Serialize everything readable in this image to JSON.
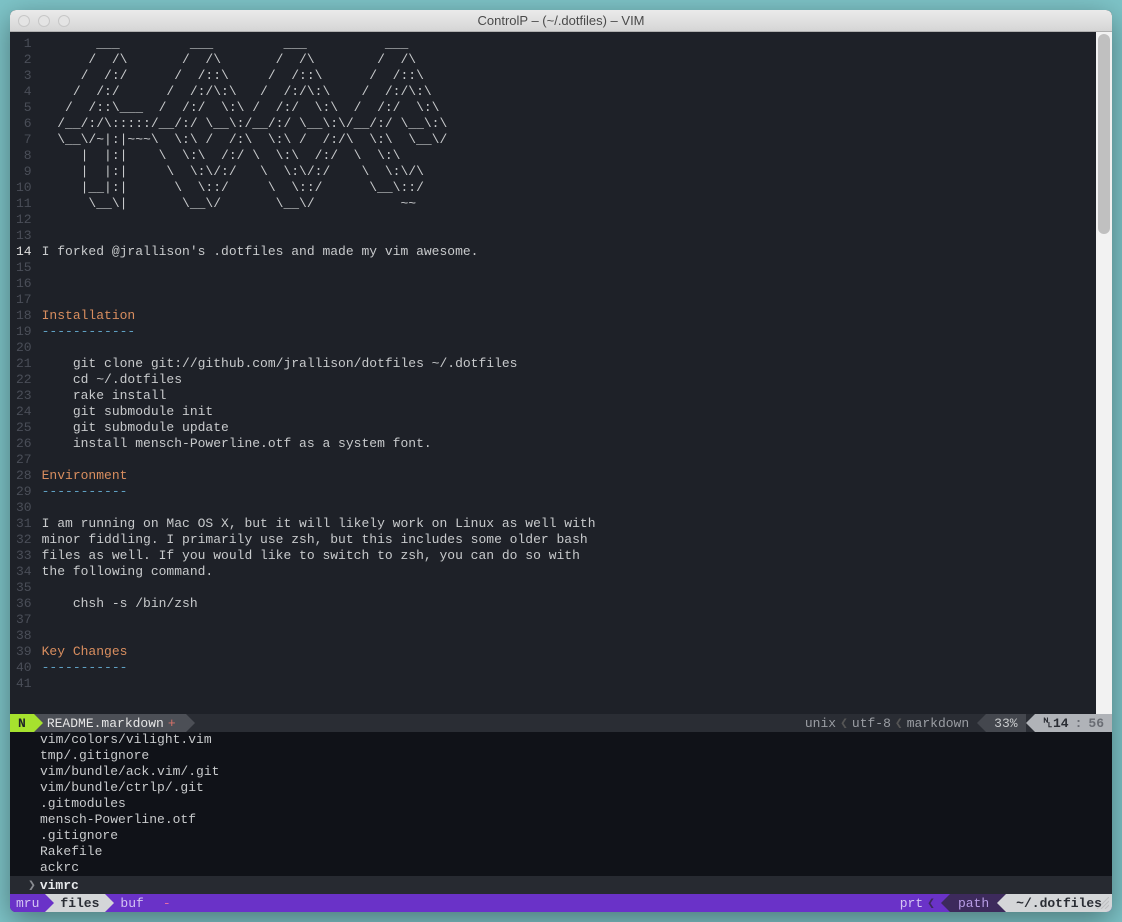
{
  "window": {
    "title": "ControlP – (~/.dotfiles) – VIM"
  },
  "editor": {
    "current_line": 14,
    "lines": [
      {
        "n": 1,
        "t": "       ___         ___         ___          ___"
      },
      {
        "n": 2,
        "t": "      /  /\\       /  /\\       /  /\\        /  /\\"
      },
      {
        "n": 3,
        "t": "     /  /:/      /  /::\\     /  /::\\      /  /::\\"
      },
      {
        "n": 4,
        "t": "    /  /:/      /  /:/\\:\\   /  /:/\\:\\    /  /:/\\:\\"
      },
      {
        "n": 5,
        "t": "   /  /::\\___  /  /:/  \\:\\ /  /:/  \\:\\  /  /:/  \\:\\"
      },
      {
        "n": 6,
        "t": "  /__/:/\\:::::/__/:/ \\__\\:/__/:/ \\__\\:\\/__/:/ \\__\\:\\"
      },
      {
        "n": 7,
        "t": "  \\__\\/~|:|~~~\\  \\:\\ /  /:\\  \\:\\ /  /:/\\  \\:\\  \\__\\/"
      },
      {
        "n": 8,
        "t": "     |  |:|    \\  \\:\\  /:/ \\  \\:\\  /:/  \\  \\:\\"
      },
      {
        "n": 9,
        "t": "     |  |:|     \\  \\:\\/:/   \\  \\:\\/:/    \\  \\:\\/\\"
      },
      {
        "n": 10,
        "t": "     |__|:|      \\  \\::/     \\  \\::/      \\__\\::/"
      },
      {
        "n": 11,
        "t": "      \\__\\|       \\__\\/       \\__\\/           ~~"
      },
      {
        "n": 12,
        "t": ""
      },
      {
        "n": 13,
        "t": ""
      },
      {
        "n": 14,
        "t": "I forked @jrallison's .dotfiles and made my vim awesome."
      },
      {
        "n": 15,
        "t": ""
      },
      {
        "n": 16,
        "t": ""
      },
      {
        "n": 17,
        "t": ""
      },
      {
        "n": 18,
        "t": "Installation",
        "cls": "heading"
      },
      {
        "n": 19,
        "t": "------------",
        "cls": "under"
      },
      {
        "n": 20,
        "t": ""
      },
      {
        "n": 21,
        "t": "    git clone git://github.com/jrallison/dotfiles ~/.dotfiles"
      },
      {
        "n": 22,
        "t": "    cd ~/.dotfiles"
      },
      {
        "n": 23,
        "t": "    rake install"
      },
      {
        "n": 24,
        "t": "    git submodule init"
      },
      {
        "n": 25,
        "t": "    git submodule update"
      },
      {
        "n": 26,
        "t": "    install mensch-Powerline.otf as a system font."
      },
      {
        "n": 27,
        "t": ""
      },
      {
        "n": 28,
        "t": "Environment",
        "cls": "heading"
      },
      {
        "n": 29,
        "t": "-----------",
        "cls": "under"
      },
      {
        "n": 30,
        "t": ""
      },
      {
        "n": 31,
        "t": "I am running on Mac OS X, but it will likely work on Linux as well with"
      },
      {
        "n": 32,
        "t": "minor fiddling. I primarily use zsh, but this includes some older bash"
      },
      {
        "n": 33,
        "t": "files as well. If you would like to switch to zsh, you can do so with"
      },
      {
        "n": 34,
        "t": "the following command."
      },
      {
        "n": 35,
        "t": ""
      },
      {
        "n": 36,
        "t": "    chsh -s /bin/zsh"
      },
      {
        "n": 37,
        "t": ""
      },
      {
        "n": 38,
        "t": ""
      },
      {
        "n": 39,
        "t": "Key Changes",
        "cls": "heading"
      },
      {
        "n": 40,
        "t": "-----------",
        "cls": "under"
      },
      {
        "n": 41,
        "t": ""
      }
    ]
  },
  "status": {
    "mode": "N",
    "filename": "README.markdown",
    "modified": "+",
    "fileformat": "unix",
    "encoding": "utf-8",
    "filetype": "markdown",
    "percent": "33%",
    "line": "14",
    "col": "56"
  },
  "ctrlp": {
    "results": [
      "vim/colors/vilight.vim",
      "tmp/.gitignore",
      "vim/bundle/ack.vim/.git",
      "vim/bundle/ctrlp/.git",
      ".gitmodules",
      "mensch-Powerline.otf",
      ".gitignore",
      "Rakefile",
      "ackrc"
    ],
    "selected": "vimrc",
    "mode_left": {
      "mru": "mru",
      "files": "files",
      "buf": "buf",
      "dash": "-"
    },
    "mode_right": {
      "prt": "prt",
      "path": "path",
      "cwd": "~/.dotfiles"
    }
  }
}
